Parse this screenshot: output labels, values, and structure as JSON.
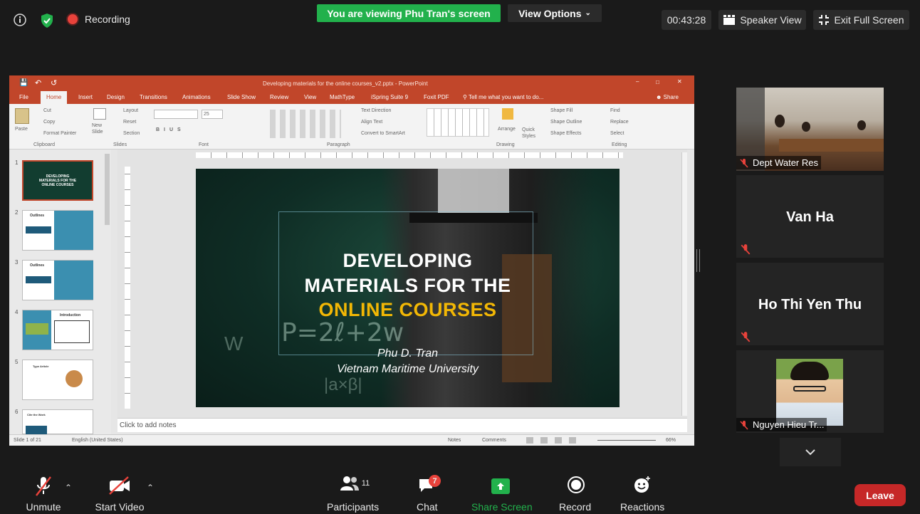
{
  "topbar": {
    "recording_label": "Recording",
    "banner": "You are viewing Phu Tran's screen",
    "view_options": "View Options",
    "timer": "00:43:28",
    "speaker_view": "Speaker View",
    "exit_fullscreen": "Exit Full Screen"
  },
  "ppt": {
    "window_title": "Developing  materials for the online courses_v2.pptx - PowerPoint",
    "tabs": [
      "File",
      "Home",
      "Insert",
      "Design",
      "Transitions",
      "Animations",
      "Slide Show",
      "Review",
      "View",
      "MathType",
      "iSpring Suite 9",
      "Foxit PDF"
    ],
    "tell_me": "Tell me what you want to do...",
    "share": "Share",
    "ribbon": {
      "cut": "Cut",
      "copy": "Copy",
      "format_painter": "Format Painter",
      "paste": "Paste",
      "new_slide": "New Slide",
      "layout": "Layout",
      "reset": "Reset",
      "section": "Section",
      "font_size": "25",
      "text_direction": "Text Direction",
      "align_text": "Align Text",
      "convert_smartart": "Convert to SmartArt",
      "arrange": "Arrange",
      "quick_styles": "Quick Styles",
      "shape_fill": "Shape Fill",
      "shape_outline": "Shape Outline",
      "shape_effects": "Shape Effects",
      "find": "Find",
      "replace": "Replace",
      "select": "Select",
      "groups": [
        "Clipboard",
        "Slides",
        "Font",
        "Paragraph",
        "Drawing",
        "Editing"
      ]
    },
    "thumbnails": [
      {
        "num": "1",
        "title": "DEVELOPING MATERIALS FOR THE ONLINE COURSES"
      },
      {
        "num": "2",
        "title": "Outlines"
      },
      {
        "num": "3",
        "title": "Outlines"
      },
      {
        "num": "4",
        "title": "Introduction"
      },
      {
        "num": "5",
        "title": "Type Article"
      },
      {
        "num": "6",
        "title": "Cite the Work"
      }
    ],
    "slide": {
      "line1": "DEVELOPING",
      "line2": "MATERIALS FOR THE",
      "line3": "ONLINE COURSES",
      "author": "Phu D. Tran",
      "affiliation": "Vietnam Maritime University",
      "formula": "P=2ℓ+2w",
      "accent_color": "#f2b705"
    },
    "notes_placeholder": "Click to add notes",
    "status_slide": "Slide 1 of 21",
    "status_lang": "English (United States)",
    "status_notes": "Notes",
    "status_comments": "Comments",
    "zoom": "66%"
  },
  "participants": [
    {
      "name": "Dept Water Res",
      "type": "video"
    },
    {
      "name": "Van Ha",
      "type": "name"
    },
    {
      "name": "Ho Thi Yen Thu",
      "type": "name"
    },
    {
      "name": "Nguyen Hieu Tr...",
      "type": "photo"
    }
  ],
  "bottombar": {
    "unmute": "Unmute",
    "start_video": "Start Video",
    "participants": "Participants",
    "participants_count": "11",
    "chat": "Chat",
    "chat_badge": "7",
    "share_screen": "Share Screen",
    "record": "Record",
    "reactions": "Reactions",
    "leave": "Leave"
  }
}
